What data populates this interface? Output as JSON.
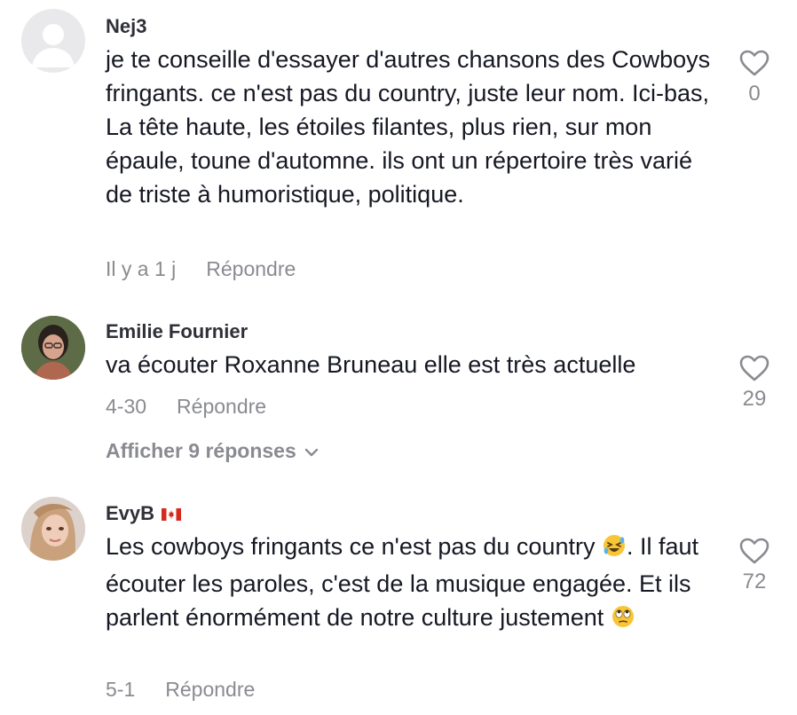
{
  "comments": [
    {
      "username": "Nej3",
      "text": "je te conseille d'essayer d'autres chansons des Cowboys fringants. ce n'est pas du country, juste leur nom. Ici-bas, La tête haute, les étoiles filantes, plus rien, sur mon épaule, toune d'automne. ils ont un répertoire très varié de triste à humoristique, politique.",
      "time": "Il y a 1 j",
      "reply_label": "Répondre",
      "likes": "0",
      "avatar_icon": "default-avatar-icon"
    },
    {
      "username": "Emilie Fournier",
      "text": "va écouter Roxanne Bruneau elle est très actuelle",
      "time": "4-30",
      "reply_label": "Répondre",
      "likes": "29",
      "view_replies": "Afficher 9 réponses",
      "avatar_icon": "user-photo-avatar"
    },
    {
      "username": "EvyB",
      "text_before_emoji": "Les cowboys fringants ce n'est pas du country ",
      "text_middle": ". Il faut écouter les paroles, c'est de la musique engagée. Et ils parlent énormément de notre culture justement ",
      "time": "5-1",
      "reply_label": "Répondre",
      "likes": "72",
      "flag_icon": "canada-flag-icon",
      "emojis": [
        "rolling-laughing-emoji",
        "eye-roll-emoji"
      ],
      "avatar_icon": "user-photo-avatar"
    }
  ],
  "colors": {
    "text": "#161823",
    "username": "#2f3038",
    "muted": "#8a8b91"
  }
}
